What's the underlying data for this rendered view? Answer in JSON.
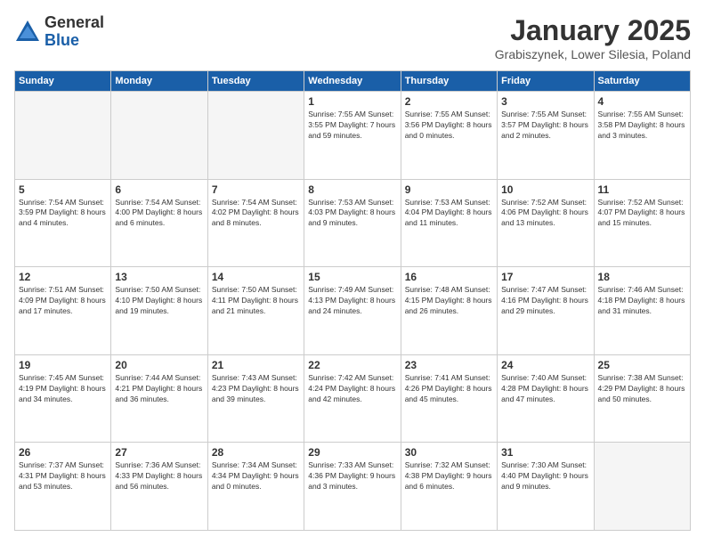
{
  "header": {
    "logo_general": "General",
    "logo_blue": "Blue",
    "month_title": "January 2025",
    "location": "Grabiszynek, Lower Silesia, Poland"
  },
  "days_of_week": [
    "Sunday",
    "Monday",
    "Tuesday",
    "Wednesday",
    "Thursday",
    "Friday",
    "Saturday"
  ],
  "weeks": [
    [
      {
        "day": "",
        "detail": ""
      },
      {
        "day": "",
        "detail": ""
      },
      {
        "day": "",
        "detail": ""
      },
      {
        "day": "1",
        "detail": "Sunrise: 7:55 AM\nSunset: 3:55 PM\nDaylight: 7 hours\nand 59 minutes."
      },
      {
        "day": "2",
        "detail": "Sunrise: 7:55 AM\nSunset: 3:56 PM\nDaylight: 8 hours\nand 0 minutes."
      },
      {
        "day": "3",
        "detail": "Sunrise: 7:55 AM\nSunset: 3:57 PM\nDaylight: 8 hours\nand 2 minutes."
      },
      {
        "day": "4",
        "detail": "Sunrise: 7:55 AM\nSunset: 3:58 PM\nDaylight: 8 hours\nand 3 minutes."
      }
    ],
    [
      {
        "day": "5",
        "detail": "Sunrise: 7:54 AM\nSunset: 3:59 PM\nDaylight: 8 hours\nand 4 minutes."
      },
      {
        "day": "6",
        "detail": "Sunrise: 7:54 AM\nSunset: 4:00 PM\nDaylight: 8 hours\nand 6 minutes."
      },
      {
        "day": "7",
        "detail": "Sunrise: 7:54 AM\nSunset: 4:02 PM\nDaylight: 8 hours\nand 8 minutes."
      },
      {
        "day": "8",
        "detail": "Sunrise: 7:53 AM\nSunset: 4:03 PM\nDaylight: 8 hours\nand 9 minutes."
      },
      {
        "day": "9",
        "detail": "Sunrise: 7:53 AM\nSunset: 4:04 PM\nDaylight: 8 hours\nand 11 minutes."
      },
      {
        "day": "10",
        "detail": "Sunrise: 7:52 AM\nSunset: 4:06 PM\nDaylight: 8 hours\nand 13 minutes."
      },
      {
        "day": "11",
        "detail": "Sunrise: 7:52 AM\nSunset: 4:07 PM\nDaylight: 8 hours\nand 15 minutes."
      }
    ],
    [
      {
        "day": "12",
        "detail": "Sunrise: 7:51 AM\nSunset: 4:09 PM\nDaylight: 8 hours\nand 17 minutes."
      },
      {
        "day": "13",
        "detail": "Sunrise: 7:50 AM\nSunset: 4:10 PM\nDaylight: 8 hours\nand 19 minutes."
      },
      {
        "day": "14",
        "detail": "Sunrise: 7:50 AM\nSunset: 4:11 PM\nDaylight: 8 hours\nand 21 minutes."
      },
      {
        "day": "15",
        "detail": "Sunrise: 7:49 AM\nSunset: 4:13 PM\nDaylight: 8 hours\nand 24 minutes."
      },
      {
        "day": "16",
        "detail": "Sunrise: 7:48 AM\nSunset: 4:15 PM\nDaylight: 8 hours\nand 26 minutes."
      },
      {
        "day": "17",
        "detail": "Sunrise: 7:47 AM\nSunset: 4:16 PM\nDaylight: 8 hours\nand 29 minutes."
      },
      {
        "day": "18",
        "detail": "Sunrise: 7:46 AM\nSunset: 4:18 PM\nDaylight: 8 hours\nand 31 minutes."
      }
    ],
    [
      {
        "day": "19",
        "detail": "Sunrise: 7:45 AM\nSunset: 4:19 PM\nDaylight: 8 hours\nand 34 minutes."
      },
      {
        "day": "20",
        "detail": "Sunrise: 7:44 AM\nSunset: 4:21 PM\nDaylight: 8 hours\nand 36 minutes."
      },
      {
        "day": "21",
        "detail": "Sunrise: 7:43 AM\nSunset: 4:23 PM\nDaylight: 8 hours\nand 39 minutes."
      },
      {
        "day": "22",
        "detail": "Sunrise: 7:42 AM\nSunset: 4:24 PM\nDaylight: 8 hours\nand 42 minutes."
      },
      {
        "day": "23",
        "detail": "Sunrise: 7:41 AM\nSunset: 4:26 PM\nDaylight: 8 hours\nand 45 minutes."
      },
      {
        "day": "24",
        "detail": "Sunrise: 7:40 AM\nSunset: 4:28 PM\nDaylight: 8 hours\nand 47 minutes."
      },
      {
        "day": "25",
        "detail": "Sunrise: 7:38 AM\nSunset: 4:29 PM\nDaylight: 8 hours\nand 50 minutes."
      }
    ],
    [
      {
        "day": "26",
        "detail": "Sunrise: 7:37 AM\nSunset: 4:31 PM\nDaylight: 8 hours\nand 53 minutes."
      },
      {
        "day": "27",
        "detail": "Sunrise: 7:36 AM\nSunset: 4:33 PM\nDaylight: 8 hours\nand 56 minutes."
      },
      {
        "day": "28",
        "detail": "Sunrise: 7:34 AM\nSunset: 4:34 PM\nDaylight: 9 hours\nand 0 minutes."
      },
      {
        "day": "29",
        "detail": "Sunrise: 7:33 AM\nSunset: 4:36 PM\nDaylight: 9 hours\nand 3 minutes."
      },
      {
        "day": "30",
        "detail": "Sunrise: 7:32 AM\nSunset: 4:38 PM\nDaylight: 9 hours\nand 6 minutes."
      },
      {
        "day": "31",
        "detail": "Sunrise: 7:30 AM\nSunset: 4:40 PM\nDaylight: 9 hours\nand 9 minutes."
      },
      {
        "day": "",
        "detail": ""
      }
    ]
  ]
}
